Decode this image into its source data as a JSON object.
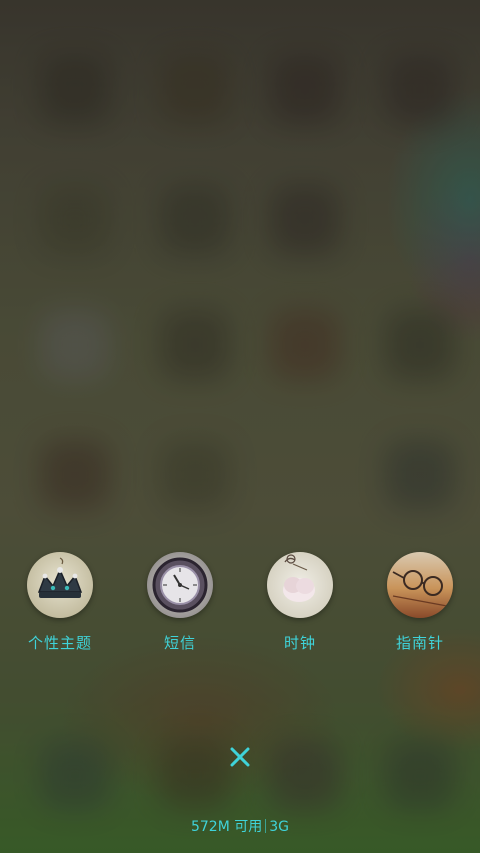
{
  "apps": [
    {
      "label": "个性主题",
      "icon": "crown-icon"
    },
    {
      "label": "短信",
      "icon": "pocket-watch-icon"
    },
    {
      "label": "时钟",
      "icon": "flower-clock-icon"
    },
    {
      "label": "指南针",
      "icon": "glasses-compass-icon"
    }
  ],
  "close": {
    "icon": "close-icon"
  },
  "status": {
    "memory": "572M 可用",
    "network": "3G"
  },
  "colors": {
    "accent": "#3fd3d9"
  }
}
